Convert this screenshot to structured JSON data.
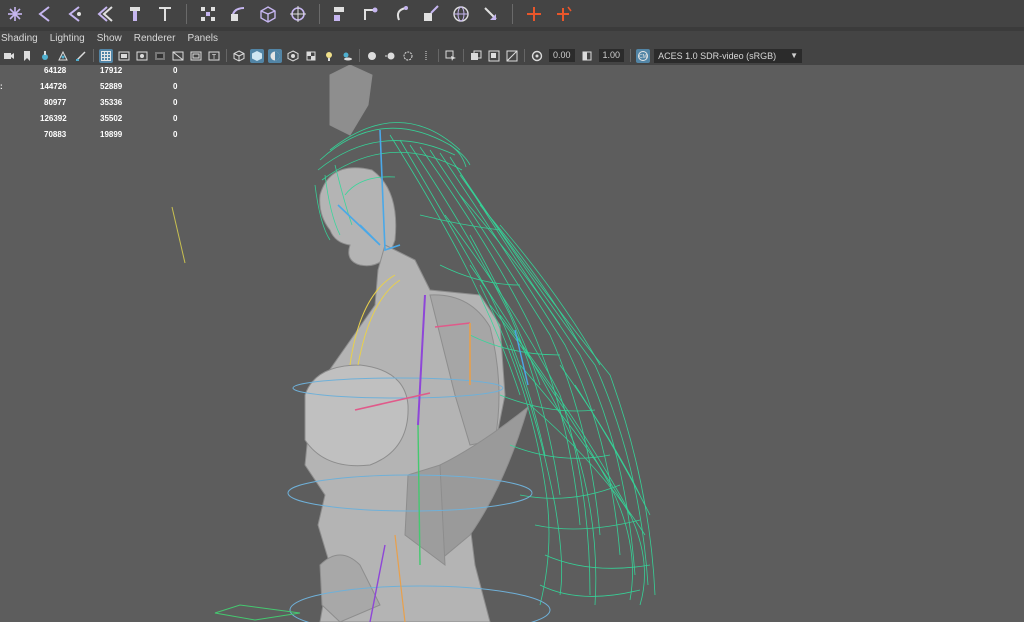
{
  "shelf": {
    "icons": [
      "snowflake-icon",
      "arrow-left-icon",
      "joint-icon",
      "double-chevron-icon",
      "hand-icon",
      "pin-icon",
      "grid-snap-icon",
      "curve-snap-icon",
      "cube-snap-icon",
      "point-snap-icon",
      "orient-icon",
      "parent-icon",
      "ik-handle-icon",
      "constraint-icon",
      "sphere-wire-icon",
      "move-tool-icon",
      "locator-icon",
      "cluster-icon"
    ]
  },
  "menu": {
    "items": [
      "Shading",
      "Lighting",
      "Show",
      "Renderer",
      "Panels"
    ]
  },
  "toolbar": {
    "exposure_value": "0.00",
    "gamma_value": "1.00",
    "colorspace_label": "ACES 1.0 SDR-video (sRGB)"
  },
  "hud": {
    "rows": [
      {
        "label": "",
        "a": "64128",
        "b": "17912",
        "c": "0"
      },
      {
        "label": ":",
        "a": "144726",
        "b": "52889",
        "c": "0"
      },
      {
        "label": "",
        "a": "80977",
        "b": "35336",
        "c": "0"
      },
      {
        "label": "",
        "a": "126392",
        "b": "35502",
        "c": "0"
      },
      {
        "label": "",
        "a": "70883",
        "b": "19899",
        "c": "0"
      }
    ]
  },
  "colors": {
    "panel_bg": "#444444",
    "viewport_bg": "#5d5d5d",
    "hair_wire": "#34d79a",
    "active_button": "#5285a6",
    "accent_orange": "#e8562a",
    "icon_lilac": "#c6b6f0"
  }
}
